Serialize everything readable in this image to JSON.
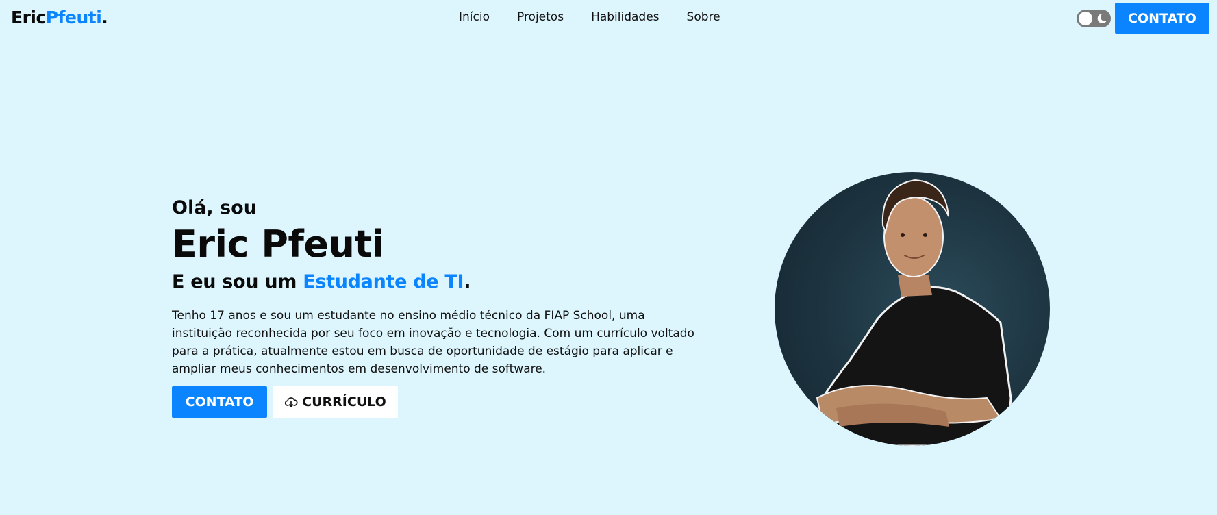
{
  "header": {
    "logo_first": "Eric",
    "logo_last": "Pfeuti",
    "logo_dot": ".",
    "nav": [
      "Início",
      "Projetos",
      "Habilidades",
      "Sobre"
    ],
    "cta_label": "CONTATO"
  },
  "hero": {
    "greeting": "Olá, sou",
    "name": "Eric Pfeuti",
    "role_prefix": "E eu sou um ",
    "role_highlight": "Estudante de TI",
    "role_suffix": ".",
    "bio": "Tenho 17 anos e sou um estudante no ensino médio técnico da FIAP School, uma instituição reconhecida por seu foco em inovação e tecnologia. Com um currículo voltado para a prática, atualmente estou em busca de oportunidade de estágio para aplicar e ampliar meus conhecimentos em desenvolvimento de software.",
    "primary_button": "CONTATO",
    "secondary_button": "CURRÍCULO"
  },
  "icons": {
    "theme_toggle": "moon-icon",
    "download": "cloud-download-icon"
  },
  "colors": {
    "background": "#ddf6fd",
    "accent": "#0a84ff",
    "text": "#0a0a0a"
  }
}
